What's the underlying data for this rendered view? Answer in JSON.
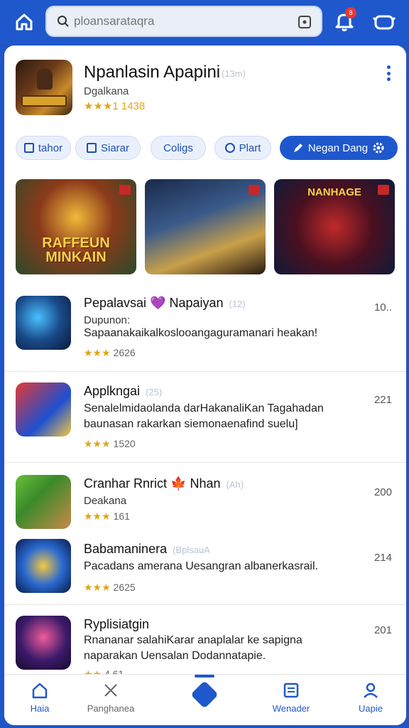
{
  "search": {
    "placeholder": "ploansarataqra"
  },
  "notifications": {
    "badge": "8"
  },
  "hero": {
    "title": "Npanlasin Apapini",
    "count": "(13m)",
    "developer": "Dgalkana",
    "stars": "★★★",
    "rating": "1 1438"
  },
  "chips": [
    {
      "label": "tahor"
    },
    {
      "label": "Siarar"
    },
    {
      "label": "Coligs"
    },
    {
      "label": "Plart"
    },
    {
      "label": "Negan Dang"
    }
  ],
  "screenshots": [
    {
      "caption": "RAFFEUN MINKAIN"
    },
    {
      "caption": ""
    },
    {
      "caption": "NANHAGE"
    }
  ],
  "apps": [
    {
      "title": "Pepalavsai 💜 Napaiyan",
      "count": "(12)",
      "developer": "Dupunon:",
      "description": "Sapaanakaikalkoslooangaguramanari heakan!",
      "stars": "★★★",
      "rating": "2626",
      "number": "10.."
    },
    {
      "title": "Applkngai",
      "count": "(25)",
      "description": "Senalelmidaolanda darHakanaliKan Tagahadan",
      "description2": "baunasan rakarkan siemonaenafind suelu]",
      "stars": "★★★",
      "rating": "1520",
      "number": "221"
    },
    {
      "title": "Cranhar Rnrict 🍁 Nhan",
      "count": "(Ah)",
      "developer": "Deakana",
      "stars": "★★★",
      "rating": "161",
      "number": "200"
    },
    {
      "title": "Babamaninera",
      "count": "(BplsauA",
      "description": "Pacadans amerana Uesangran albanerkasrail.",
      "stars": "★★★",
      "rating": "2625",
      "number": "214"
    },
    {
      "title": "Ryplisiatgin",
      "count": "",
      "description": "Rnananar salahiKarar anaplalar ke sapigna",
      "description2": "naparakan Uensalan Dodannatapie.",
      "stars": "★★",
      "rating": "4.61",
      "number": "201"
    }
  ],
  "bottom_nav": [
    {
      "label": "Haia"
    },
    {
      "label": "Panghanea"
    },
    {
      "label": ""
    },
    {
      "label": "Wenader"
    },
    {
      "label": "Uapie"
    }
  ],
  "colors": {
    "primary": "#1f58cc",
    "star": "#e0a515"
  }
}
